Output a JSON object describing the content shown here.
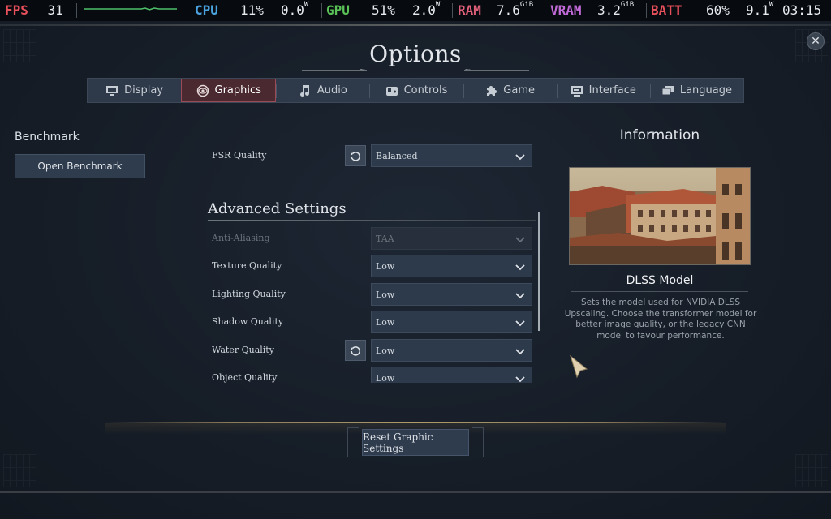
{
  "overlay": {
    "fps": {
      "label": "FPS",
      "value": "31",
      "color": "#e8505b"
    },
    "cpu": {
      "label": "CPU",
      "usage": "11%",
      "power": "0.0",
      "power_unit": "W",
      "color": "#4aa3df"
    },
    "gpu": {
      "label": "GPU",
      "usage": "51%",
      "power": "2.0",
      "power_unit": "W",
      "color": "#59c157"
    },
    "ram": {
      "label": "RAM",
      "value": "7.6",
      "unit": "GiB",
      "color": "#e0607a"
    },
    "vram": {
      "label": "VRAM",
      "value": "3.2",
      "unit": "GiB",
      "color": "#c06ad8"
    },
    "batt": {
      "label": "BATT",
      "value": "60%",
      "power": "9.1",
      "power_unit": "W",
      "color": "#e8505b"
    },
    "clock": "03:15"
  },
  "window": {
    "title": "Options",
    "close_icon": "close-icon"
  },
  "tabs": [
    {
      "label": "Display",
      "icon": "monitor-icon",
      "active": false
    },
    {
      "label": "Graphics",
      "icon": "eye-icon",
      "active": true
    },
    {
      "label": "Audio",
      "icon": "music-note-icon",
      "active": false
    },
    {
      "label": "Controls",
      "icon": "gamepad-icon",
      "active": false
    },
    {
      "label": "Game",
      "icon": "puzzle-icon",
      "active": false
    },
    {
      "label": "Interface",
      "icon": "screen-icon",
      "active": false
    },
    {
      "label": "Language",
      "icon": "speech-icon",
      "active": false
    }
  ],
  "benchmark": {
    "title": "Benchmark",
    "button": "Open Benchmark"
  },
  "settings": {
    "fsr": {
      "label": "FSR Quality",
      "value": "Balanced"
    },
    "advanced_title": "Advanced Settings",
    "rows": [
      {
        "label": "Anti-Aliasing",
        "value": "TAA",
        "disabled": true
      },
      {
        "label": "Texture Quality",
        "value": "Low"
      },
      {
        "label": "Lighting Quality",
        "value": "Low"
      },
      {
        "label": "Shadow Quality",
        "value": "Low"
      },
      {
        "label": "Water Quality",
        "value": "Low",
        "has_reset": true
      },
      {
        "label": "Object Quality",
        "value": "Low"
      }
    ]
  },
  "info": {
    "title": "Information",
    "heading": "DLSS Model",
    "description": "Sets the model used for NVIDIA DLSS Upscaling. Choose the transformer model for better image quality, or the legacy CNN model to favour performance."
  },
  "footer": {
    "reset_button": "Reset Graphic Settings"
  }
}
